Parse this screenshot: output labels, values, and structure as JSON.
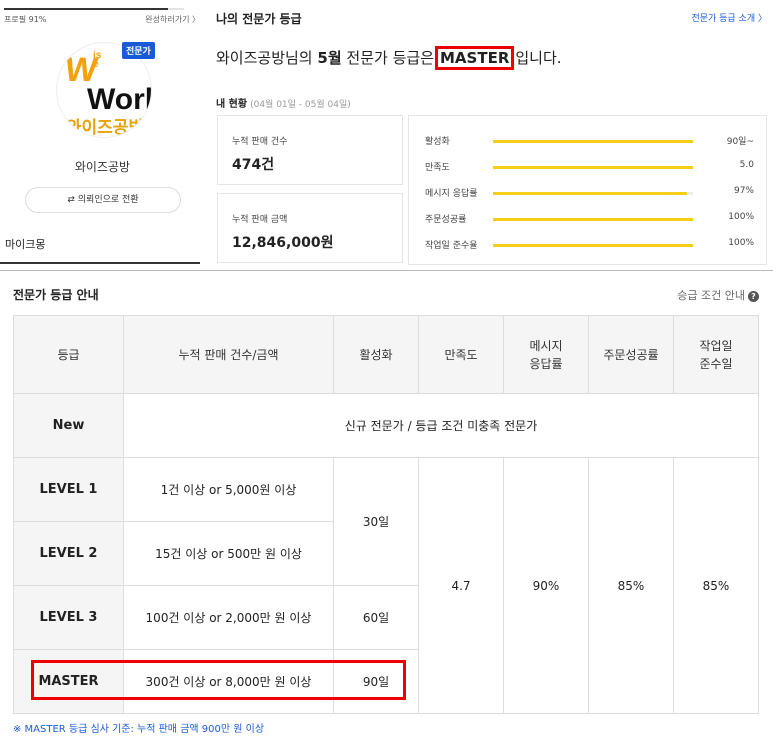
{
  "profile": {
    "progress_label": "프로필 91%",
    "progress_value": 0.91,
    "complete_link": "완성하러가기 〉",
    "expert_badge": "전문가",
    "logo_top": "W",
    "logo_ise": "ise",
    "logo_work": "Work",
    "logo_korean": "와이즈공방",
    "name": "와이즈공방",
    "switch_button": "⇄  의뢰인으로 전환",
    "mypage": "마이크몽"
  },
  "grade": {
    "title": "나의 전문가 등급",
    "intro_link": "전문가 등급 소개 〉",
    "msg_prefix": "와이즈공방님의",
    "msg_month": "5월",
    "msg_mid": "전문가 등급은",
    "msg_grade": "MASTER",
    "msg_suffix": "입니다.",
    "status_title": "내 현황",
    "status_period": "(04월 01일 - 05월 04일)",
    "stats": [
      {
        "label": "누적 판매 건수",
        "value": "474건"
      },
      {
        "label": "누적 판매 금액",
        "value": "12,846,000원"
      }
    ],
    "metrics": [
      {
        "label": "활성화",
        "value": "90일~",
        "fill": 1.0
      },
      {
        "label": "만족도",
        "value": "5.0",
        "fill": 1.0
      },
      {
        "label": "메시지 응답률",
        "value": "97%",
        "fill": 0.97
      },
      {
        "label": "주문성공률",
        "value": "100%",
        "fill": 1.0
      },
      {
        "label": "작업일 준수율",
        "value": "100%",
        "fill": 1.0
      }
    ]
  },
  "guide": {
    "title": "전문가 등급 안내",
    "condition_link": "승급 조건 안내",
    "condition_icon": "?",
    "headers": [
      "등급",
      "누적 판매 건수/금액",
      "활성화",
      "만족도",
      "메시지\n응답률",
      "주문성공률",
      "작업일\n준수일"
    ],
    "new_row": {
      "grade": "New",
      "desc": "신규 전문가 / 등급 조건 미충족 전문가"
    },
    "levels": [
      {
        "grade": "LEVEL 1",
        "sales": "1건 이상 or 5,000원 이상"
      },
      {
        "grade": "LEVEL 2",
        "sales": "15건 이상 or 500만 원 이상"
      },
      {
        "grade": "LEVEL 3",
        "sales": "100건 이상 or 2,000만 원 이상"
      },
      {
        "grade": "MASTER",
        "sales": "300건 이상 or 8,000만 원 이상"
      }
    ],
    "activation": [
      "30일",
      "60일",
      "90일"
    ],
    "satisfaction": "4.7",
    "response_rate": "90%",
    "order_success": "85%",
    "work_compliance": "85%",
    "footnote": "※ MASTER 등급 심사 기준: 누적 판매 금액 900만 원 이상"
  },
  "colors": {
    "accent": "#1a5ad9",
    "highlight": "#e00000",
    "bar": "#f5cf17"
  }
}
